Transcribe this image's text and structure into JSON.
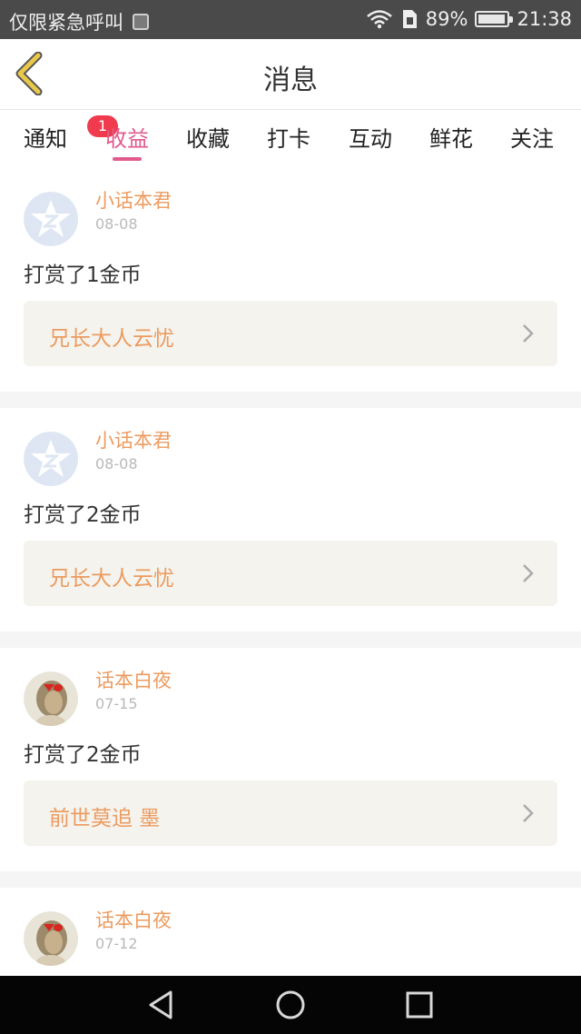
{
  "status_bar": {
    "carrier": "仅限紧急呼叫",
    "battery": "89%",
    "time": "21:38",
    "icons": [
      "picture-icon",
      "wifi-icon",
      "sim-icon",
      "battery-icon"
    ]
  },
  "header": {
    "title": "消息",
    "back_icon": "chevron-left-icon"
  },
  "tabs": [
    {
      "label": "通知",
      "badge": "1"
    },
    {
      "label": "收益",
      "active": true
    },
    {
      "label": "收藏"
    },
    {
      "label": "打卡"
    },
    {
      "label": "互动"
    },
    {
      "label": "鲜花"
    },
    {
      "label": "关注"
    }
  ],
  "items": [
    {
      "name": "小话本君",
      "date": "08-08",
      "message": "打赏了1金币",
      "link": "兄长大人云忧",
      "avatar": "star-logo"
    },
    {
      "name": "小话本君",
      "date": "08-08",
      "message": "打赏了2金币",
      "link": "兄长大人云忧",
      "avatar": "star-logo"
    },
    {
      "name": "话本白夜",
      "date": "07-15",
      "message": "打赏了2金币",
      "link": "前世莫追 墨",
      "avatar": "photo"
    },
    {
      "name": "话本白夜",
      "date": "07-12",
      "avatar": "photo"
    }
  ],
  "colors": {
    "accent": "#e05a8d",
    "orange": "#ec9b5f",
    "badge": "#ef3b4d",
    "back_icon": "#e8c84a"
  },
  "nav_bar": [
    "back-triangle-icon",
    "home-circle-icon",
    "recent-square-icon"
  ]
}
